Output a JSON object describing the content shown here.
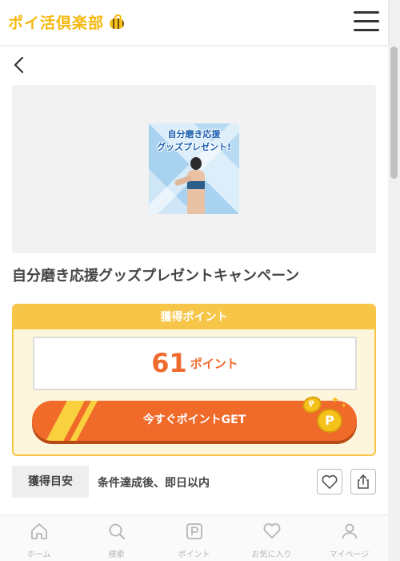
{
  "header": {
    "logo_text": "ポイ活倶楽部",
    "logo_icon": "bee-icon",
    "menu_icon": "hamburger-menu-icon"
  },
  "nav": {
    "back_icon": "chevron-left-icon"
  },
  "banner": {
    "line1": "自分磨き応援",
    "line2": "グッズプレゼント!"
  },
  "campaign": {
    "title": "自分磨き応援グッズプレゼントキャンペーン",
    "points_header": "獲得ポイント",
    "points_value": "61",
    "points_unit": "ポイント",
    "get_button": "今すぐポイントGET",
    "coin_label": "P",
    "estimate_label": "獲得目安",
    "estimate_value": "条件達成後、即日以内"
  },
  "actions": {
    "favorite_icon": "heart-icon",
    "share_icon": "share-icon"
  },
  "bottom_nav": [
    {
      "label": "ホーム",
      "icon": "home-icon"
    },
    {
      "label": "検索",
      "icon": "search-icon"
    },
    {
      "label": "ポイント",
      "icon": "point-icon"
    },
    {
      "label": "お気に入り",
      "icon": "heart-icon"
    },
    {
      "label": "マイページ",
      "icon": "user-icon"
    }
  ],
  "colors": {
    "accent_orange": "#f06a2a",
    "accent_yellow": "#f7c548",
    "logo_yellow": "#f5b80f"
  }
}
